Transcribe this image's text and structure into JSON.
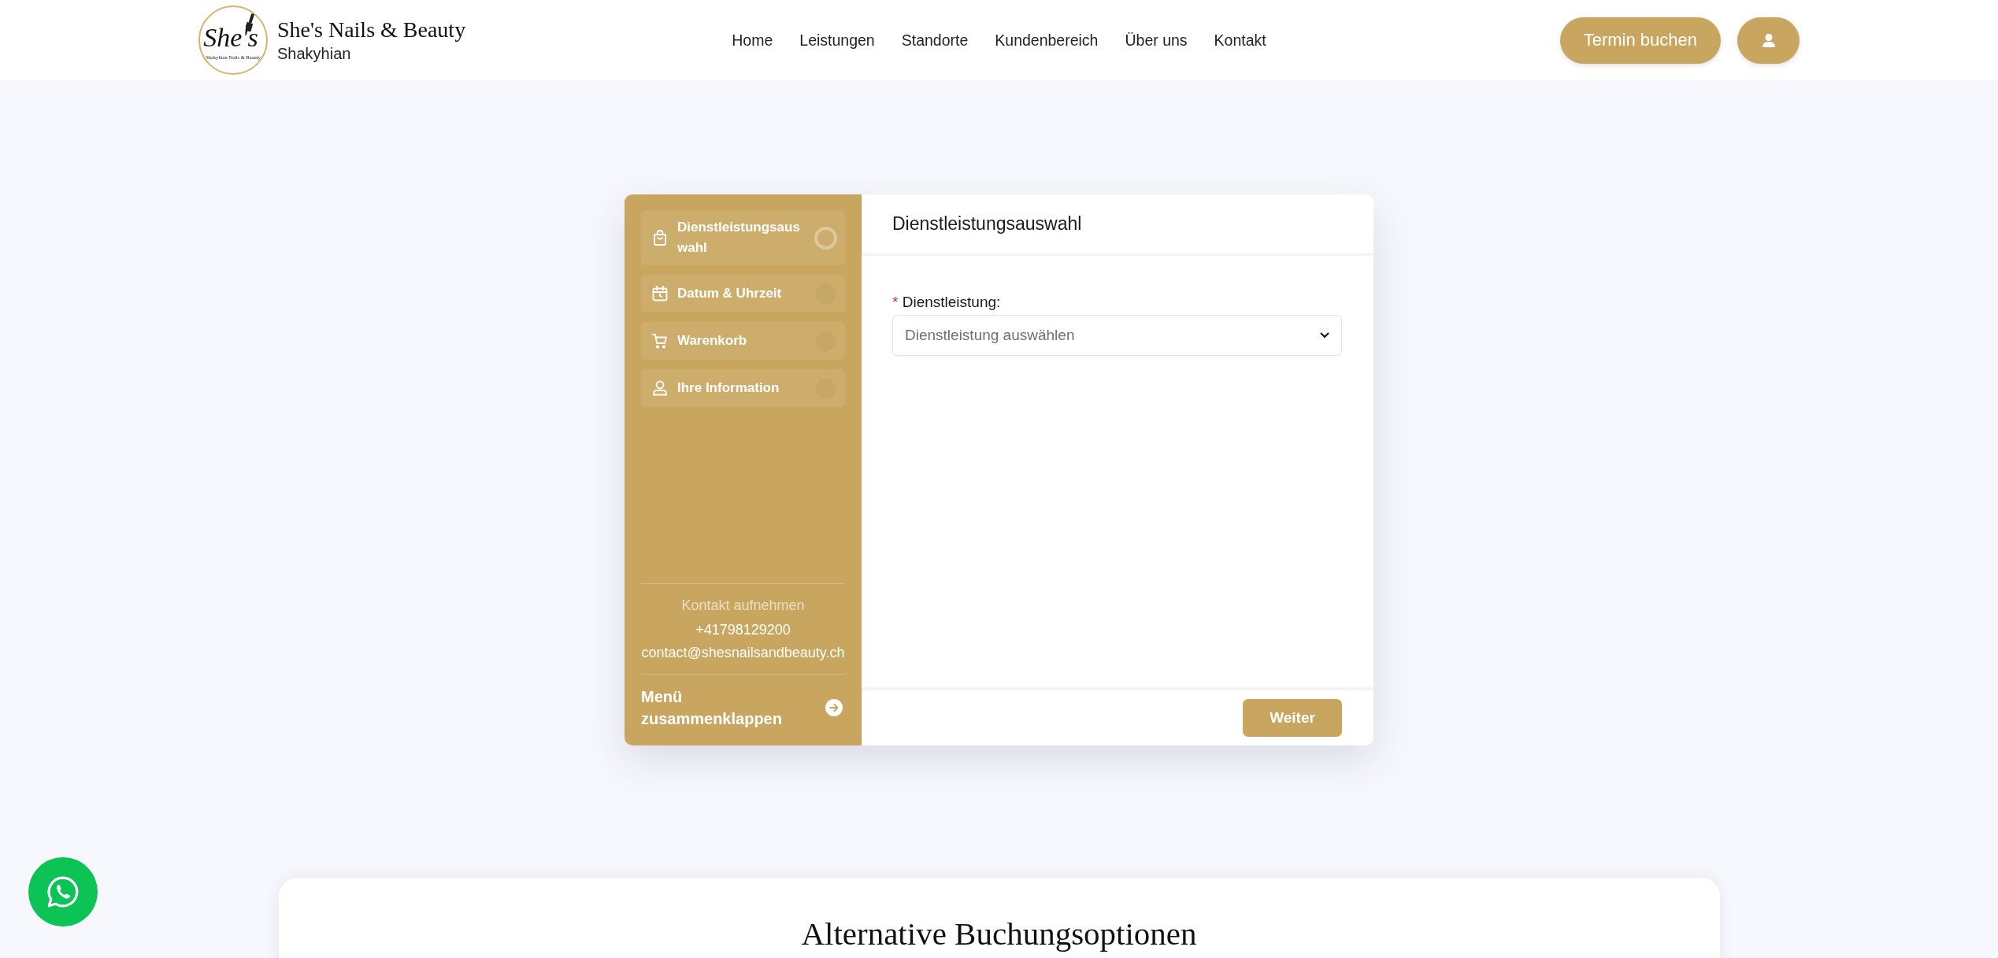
{
  "header": {
    "logo": {
      "script": "She's",
      "tagline": "Shakyhian Nails & Beauty"
    },
    "brand_title": "She's Nails & Beauty",
    "brand_subtitle": "Shakyhian",
    "nav": [
      {
        "label": "Home"
      },
      {
        "label": "Leistungen"
      },
      {
        "label": "Standorte"
      },
      {
        "label": "Kundenbereich"
      },
      {
        "label": "Über uns"
      },
      {
        "label": "Kontakt"
      }
    ],
    "cta_button": "Termin buchen"
  },
  "booking": {
    "steps": [
      {
        "label": "Dienstleistungsauswahl",
        "kind": "bag",
        "selected": true
      },
      {
        "label": "Datum & Uhrzeit",
        "kind": "calendar",
        "selected": false
      },
      {
        "label": "Warenkorb",
        "kind": "cart",
        "selected": false
      },
      {
        "label": "Ihre Information",
        "kind": "person",
        "selected": false
      }
    ],
    "contact": {
      "heading": "Kontakt aufnehmen",
      "phone": "+41798129200",
      "email": "contact@shesnailsandbeauty.ch"
    },
    "collapse_label": "Menü zusammenklappen",
    "panel": {
      "title": "Dienstleistungsauswahl",
      "field": {
        "required_mark": "*",
        "label": "Dienstleistung:",
        "placeholder": "Dienstleistung auswählen"
      },
      "next_button": "Weiter"
    }
  },
  "alternative": {
    "title": "Alternative Buchungsoptionen"
  }
}
